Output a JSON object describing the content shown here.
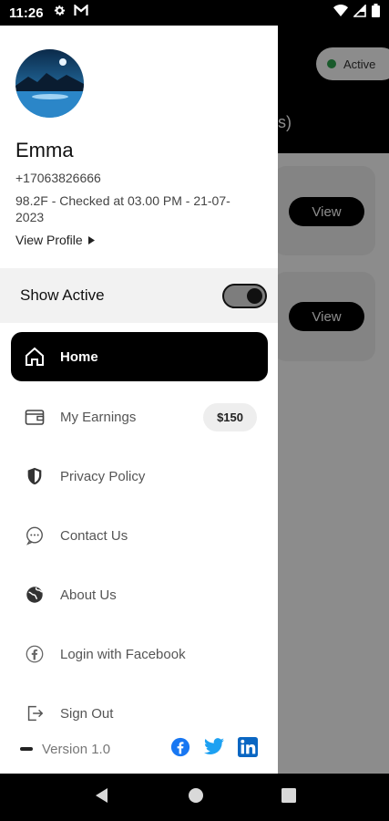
{
  "status_bar": {
    "time": "11:26"
  },
  "background": {
    "active_pill": "Active",
    "header_fragment": "s)",
    "view_buttons": [
      "View",
      "View"
    ]
  },
  "profile": {
    "name": "Emma",
    "phone": "+17063826666",
    "temperature_status": "98.2F - Checked at 03.00 PM - 21-07-2023",
    "view_profile": "View Profile"
  },
  "show_active": {
    "label": "Show Active",
    "enabled": true
  },
  "menu": {
    "home": "Home",
    "earnings": "My Earnings",
    "earnings_amount": "$150",
    "privacy": "Privacy Policy",
    "contact": "Contact Us",
    "about": "About Us",
    "facebook_login": "Login with Facebook",
    "sign_out": "Sign Out"
  },
  "footer": {
    "version": "Version 1.0"
  },
  "colors": {
    "accent": "#000000",
    "active_dot": "#2ea44f",
    "facebook": "#1877f2",
    "twitter": "#1da1f2",
    "linkedin": "#0a66c2"
  }
}
